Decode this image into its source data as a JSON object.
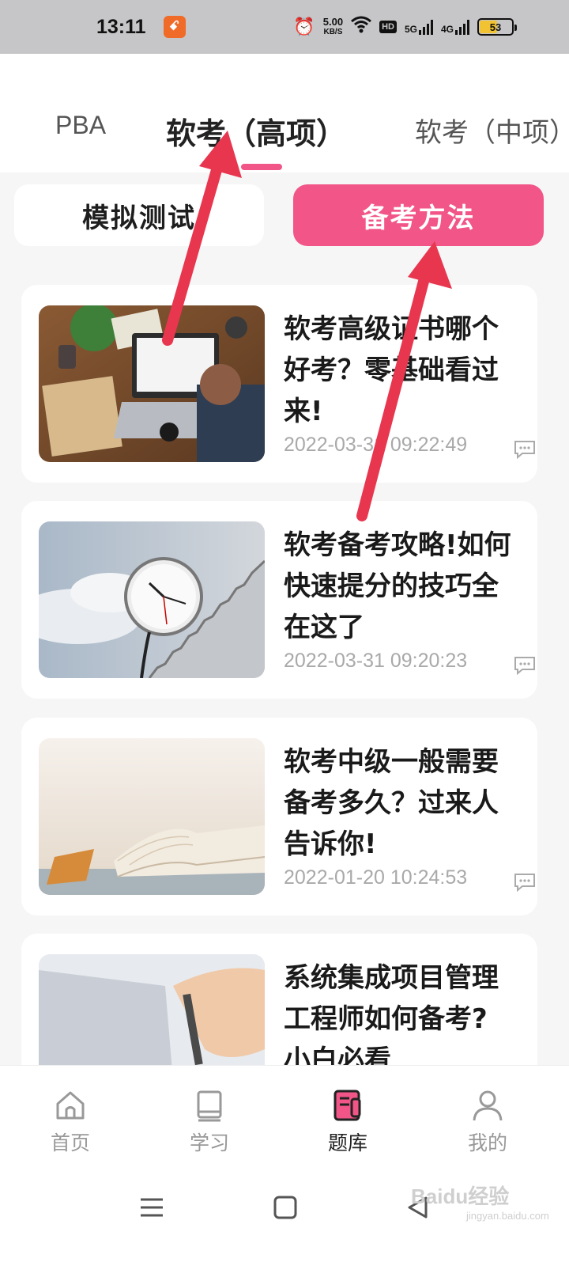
{
  "status_bar": {
    "time": "13:11",
    "app_icon_glyph": "ꗃ",
    "speed_value": "5.00",
    "speed_unit": "KB/S",
    "hd_label": "HD",
    "net_5g": "5G",
    "net_4g": "4G",
    "battery": "53"
  },
  "tabs": [
    {
      "label": "PBA"
    },
    {
      "label": "软考（高项）"
    },
    {
      "label": "软考（中项）"
    }
  ],
  "segments": {
    "mock": "模拟测试",
    "method": "备考方法"
  },
  "articles": [
    {
      "title": "软考高级证书哪个好考？零基础看过来!",
      "date": "2022-03-31 09:22:49"
    },
    {
      "title": "软考备考攻略!如何快速提分的技巧全在这了",
      "date": "2022-03-31 09:20:23"
    },
    {
      "title": "软考中级一般需要备考多久？过来人告诉你!",
      "date": "2022-01-20 10:24:53"
    },
    {
      "title": "系统集成项目管理工程师如何备考?小白必看",
      "date": ""
    }
  ],
  "bottom_nav": [
    {
      "label": "首页",
      "icon": "home-icon"
    },
    {
      "label": "学习",
      "icon": "book-icon"
    },
    {
      "label": "题库",
      "icon": "question-bank-icon"
    },
    {
      "label": "我的",
      "icon": "user-icon"
    }
  ],
  "watermark": {
    "brand": "Baidu经验",
    "url": "jingyan.baidu.com"
  },
  "colors": {
    "accent": "#f25587",
    "annotation_arrow": "#e8364f"
  }
}
